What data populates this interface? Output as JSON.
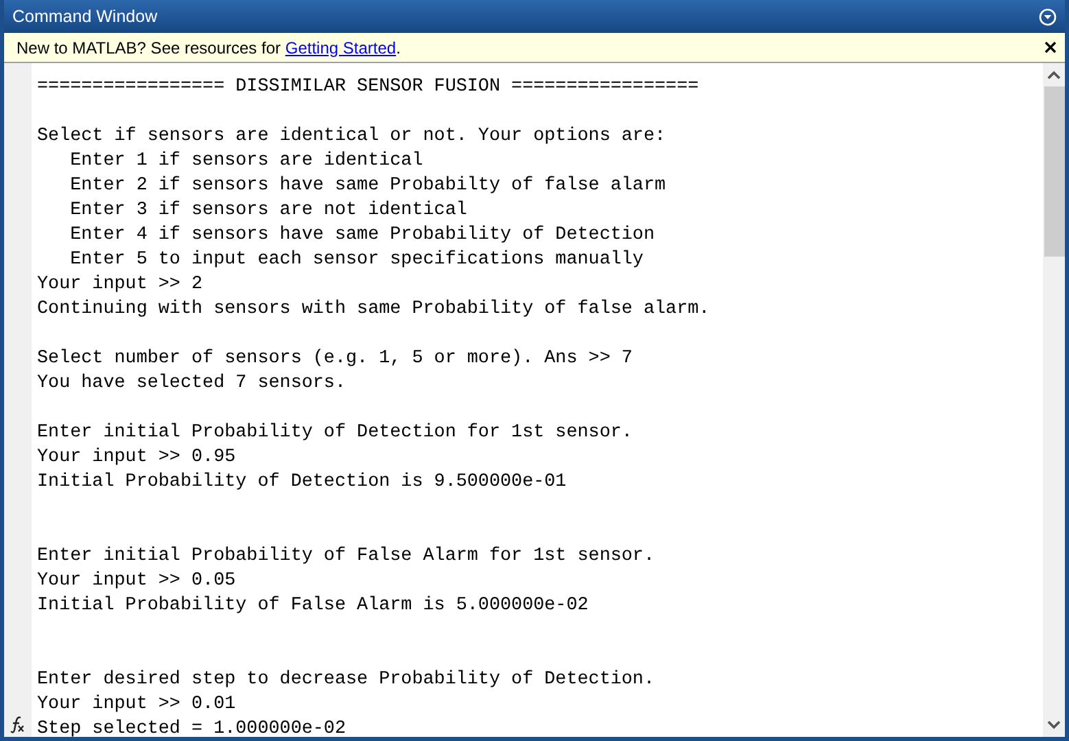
{
  "window": {
    "title": "Command Window"
  },
  "banner": {
    "text": "New to MATLAB? See resources for ",
    "link": "Getting Started",
    "after": "."
  },
  "paragraphs": [
    {
      "kind": "first",
      "lines": [
        "================= DISSIMILAR SENSOR FUSION ================="
      ]
    },
    {
      "kind": "spaced",
      "lines": [
        "Select if sensors are identical or not. Your options are:",
        "   Enter 1 if sensors are identical",
        "   Enter 2 if sensors have same Probabilty of false alarm",
        "   Enter 3 if sensors are not identical",
        "   Enter 4 if sensors have same Probability of Detection",
        "   Enter 5 to input each sensor specifications manually",
        "Your input >> 2",
        "Continuing with sensors with same Probability of false alarm."
      ]
    },
    {
      "kind": "spaced",
      "lines": [
        "Select number of sensors (e.g. 1, 5 or more). Ans >> 7",
        "You have selected 7 sensors."
      ]
    },
    {
      "kind": "spaced",
      "lines": [
        "Enter initial Probability of Detection for 1st sensor.",
        "Your input >> 0.95",
        "Initial Probability of Detection is 9.500000e-01"
      ]
    },
    {
      "kind": "wide",
      "lines": [
        "Enter initial Probability of False Alarm for 1st sensor.",
        "Your input >> 0.05",
        "Initial Probability of False Alarm is 5.000000e-02"
      ]
    },
    {
      "kind": "wide",
      "lines": [
        "Enter desired step to decrease Probability of Detection.",
        "Your input >> 0.01",
        "Step selected = 1.000000e-02"
      ]
    }
  ]
}
